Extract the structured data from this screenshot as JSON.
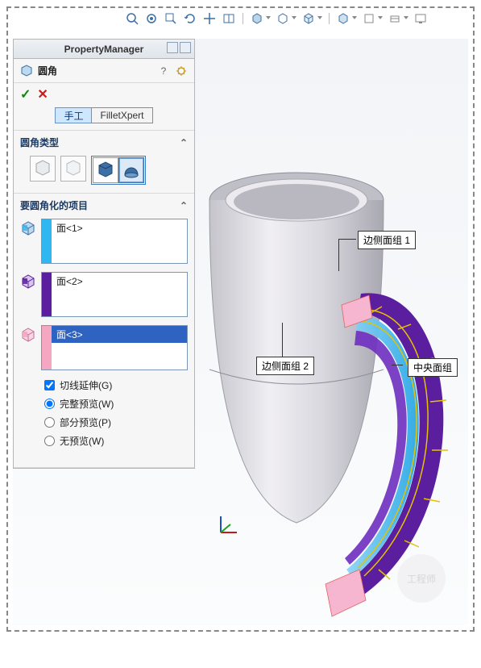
{
  "pm": {
    "title": "PropertyManager",
    "feature_name": "圆角",
    "help_glyph": "?",
    "mode": {
      "manual": "手工",
      "filletxpert": "FilletXpert",
      "active": "manual"
    },
    "section_type": {
      "label": "圆角类型"
    },
    "section_items": {
      "label": "要圆角化的项目"
    },
    "items": [
      {
        "box_label": "面<1>",
        "stripe": "cyan",
        "selected": false
      },
      {
        "box_label": "面<2>",
        "stripe": "purple",
        "selected": false
      },
      {
        "box_label": "面<3>",
        "stripe": "pink",
        "selected": true
      }
    ],
    "options": {
      "tangent": {
        "label": "切线延伸(G)",
        "checked": true
      },
      "preview_full": {
        "label": "完整预览(W)"
      },
      "preview_partial": {
        "label": "部分预览(P)"
      },
      "preview_none": {
        "label": "无预览(W)"
      },
      "preview_value": "full"
    }
  },
  "callouts": {
    "side_group_1": "边侧面组 1",
    "side_group_2": "边侧面组 2",
    "center_group": "中央面组"
  },
  "watermark_text": "工程师"
}
